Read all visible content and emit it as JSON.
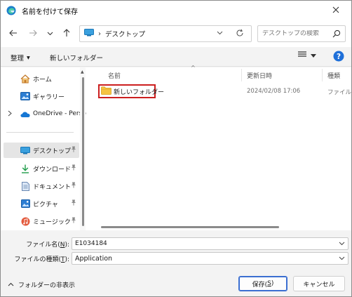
{
  "window": {
    "title": "名前を付けて保存",
    "app_icon": "edge-icon",
    "close_icon": "close-icon"
  },
  "navigation": {
    "back_icon": "arrow-left-icon",
    "forward_icon": "arrow-right-icon",
    "recent_icon": "chevron-down-icon",
    "up_icon": "arrow-up-icon"
  },
  "address": {
    "separator": "›",
    "path": "デスクトップ",
    "refresh_icon": "refresh-icon"
  },
  "search": {
    "placeholder": "デスクトップの検索"
  },
  "toolbar": {
    "organize_label": "整理",
    "organize_arrow": "▾",
    "new_folder_label": "新しいフォルダー",
    "view_icon": "list-view-icon",
    "help_label": "?"
  },
  "sidebar": {
    "items": [
      {
        "label": "ホーム",
        "icon": "home-icon",
        "pinned": false
      },
      {
        "label": "ギャラリー",
        "icon": "gallery-icon",
        "pinned": false
      },
      {
        "label": "OneDrive - Perso",
        "icon": "onedrive-icon",
        "pinned": false,
        "expandable": true
      },
      {
        "label": "デスクトップ",
        "icon": "desktop-icon",
        "pinned": true,
        "selected": true
      },
      {
        "label": "ダウンロード",
        "icon": "download-icon",
        "pinned": true
      },
      {
        "label": "ドキュメント",
        "icon": "document-icon",
        "pinned": true
      },
      {
        "label": "ピクチャ",
        "icon": "pictures-icon",
        "pinned": true
      },
      {
        "label": "ミュージック",
        "icon": "music-icon",
        "pinned": true
      }
    ]
  },
  "filelist": {
    "columns": [
      "名前",
      "更新日時",
      "種類"
    ],
    "rows": [
      {
        "name": "新しいフォルダー",
        "modified": "2024/02/08 17:06",
        "type": "ファイル フ"
      }
    ]
  },
  "fields": {
    "filename_label_prefix": "ファイル名(",
    "filename_label_key": "N",
    "filename_label_suffix": "):",
    "filename_value": "E1034184",
    "filetype_label_prefix": "ファイルの種類(",
    "filetype_label_key": "T",
    "filetype_label_suffix": "):",
    "filetype_value": "Application"
  },
  "footer": {
    "hide_folders_label": "フォルダーの非表示",
    "save_prefix": "保存(",
    "save_key": "S",
    "save_suffix": ")",
    "cancel_label": "キャンセル"
  },
  "colors": {
    "accent": "#3b6fd1",
    "highlight_box": "#cc1f1f",
    "folder": "#f5c342",
    "selected_bg": "#e5e5e5"
  }
}
